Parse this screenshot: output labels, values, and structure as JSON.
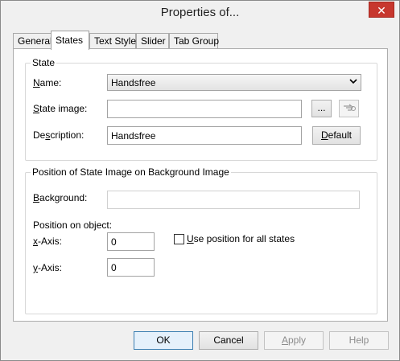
{
  "window": {
    "title": "Properties of...",
    "close_glyph": "✕"
  },
  "tabs": [
    {
      "label": "General"
    },
    {
      "label": "States"
    },
    {
      "label": "Text Style"
    },
    {
      "label": "Slider"
    },
    {
      "label": "Tab Group"
    }
  ],
  "state_group": {
    "title": "State",
    "name_label_mnemonic": "N",
    "name_label_rest": "ame:",
    "name_value": "Handsfree",
    "state_image_label_mnemonic": "S",
    "state_image_label_rest": "tate image:",
    "state_image_value": "",
    "browse_label": "...",
    "description_label_pre": "De",
    "description_label_mnemonic": "s",
    "description_label_rest": "cription:",
    "description_value": "Handsfree",
    "default_label_mnemonic": "D",
    "default_label_rest": "efault"
  },
  "position_group": {
    "title": "Position of State Image on Background Image",
    "background_label_mnemonic": "B",
    "background_label_rest": "ackground:",
    "background_value": "",
    "position_on_object_label": "Position on object:",
    "x_label_mnemonic": "x",
    "x_label_rest": "-Axis:",
    "x_value": "0",
    "y_label_mnemonic": "y",
    "y_label_rest": "-Axis:",
    "y_value": "0",
    "use_position_mnemonic": "U",
    "use_position_rest": "se position for all states",
    "use_position_checked": false
  },
  "footer": {
    "ok": "OK",
    "cancel": "Cancel",
    "apply_mnemonic": "A",
    "apply_rest": "pply",
    "help": "Help"
  },
  "icons": {
    "dropdown": "chevron-down-icon",
    "pick": "pointer-hand-icon",
    "close": "close-icon"
  }
}
